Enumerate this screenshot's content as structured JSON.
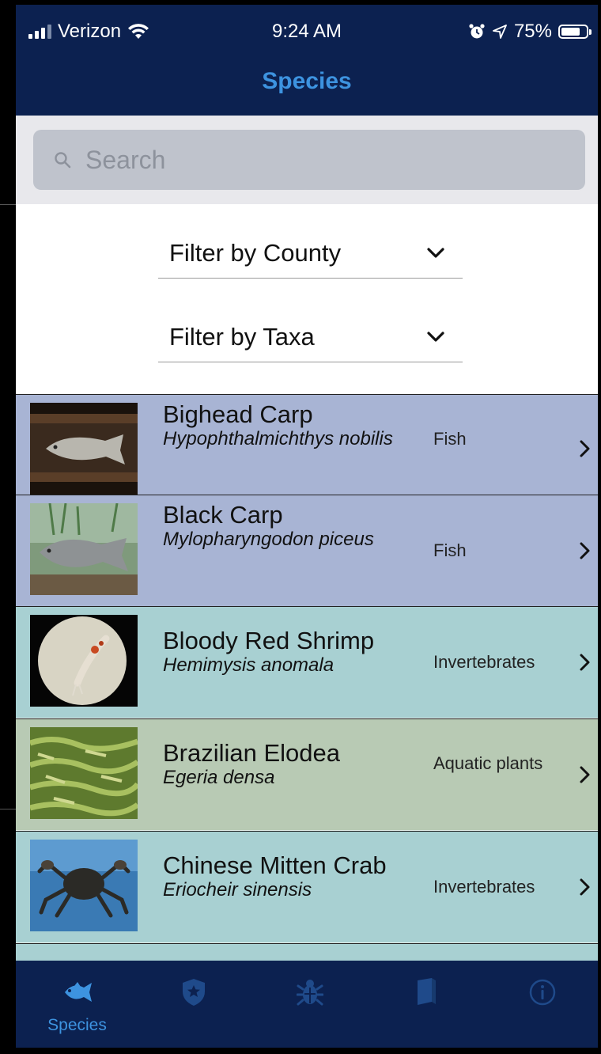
{
  "status_bar": {
    "carrier": "Verizon",
    "time": "9:24 AM",
    "battery": "75%",
    "battery_level": 0.75
  },
  "nav": {
    "title": "Species"
  },
  "search": {
    "placeholder": "Search"
  },
  "filters": [
    {
      "label": "Filter by County"
    },
    {
      "label": "Filter by Taxa"
    }
  ],
  "species": [
    {
      "common": "Bighead Carp",
      "scientific": "Hypophthalmichthys nobilis",
      "taxa": "Fish",
      "bg": "#a8b4d4"
    },
    {
      "common": "Black Carp",
      "scientific": "Mylopharyngodon piceus",
      "taxa": "Fish",
      "bg": "#a8b4d4"
    },
    {
      "common": "Bloody Red Shrimp",
      "scientific": "Hemimysis anomala",
      "taxa": "Invertebrates",
      "bg": "#a8d0d2"
    },
    {
      "common": "Brazilian Elodea",
      "scientific": "Egeria densa",
      "taxa": "Aquatic plants",
      "bg": "#b8cab4"
    },
    {
      "common": "Chinese Mitten Crab",
      "scientific": "Eriocheir sinensis",
      "taxa": "Invertebrates",
      "bg": "#a8d0d2"
    }
  ],
  "tabs": [
    {
      "label": "Species",
      "icon": "fish-icon",
      "active": true
    },
    {
      "label": "",
      "icon": "shield-star-icon"
    },
    {
      "label": "",
      "icon": "bug-icon"
    },
    {
      "label": "",
      "icon": "book-icon"
    },
    {
      "label": "",
      "icon": "info-icon"
    }
  ],
  "colors": {
    "navy": "#0c2150",
    "accent": "#3d93e0",
    "icon_inactive": "#1f4a8a"
  }
}
